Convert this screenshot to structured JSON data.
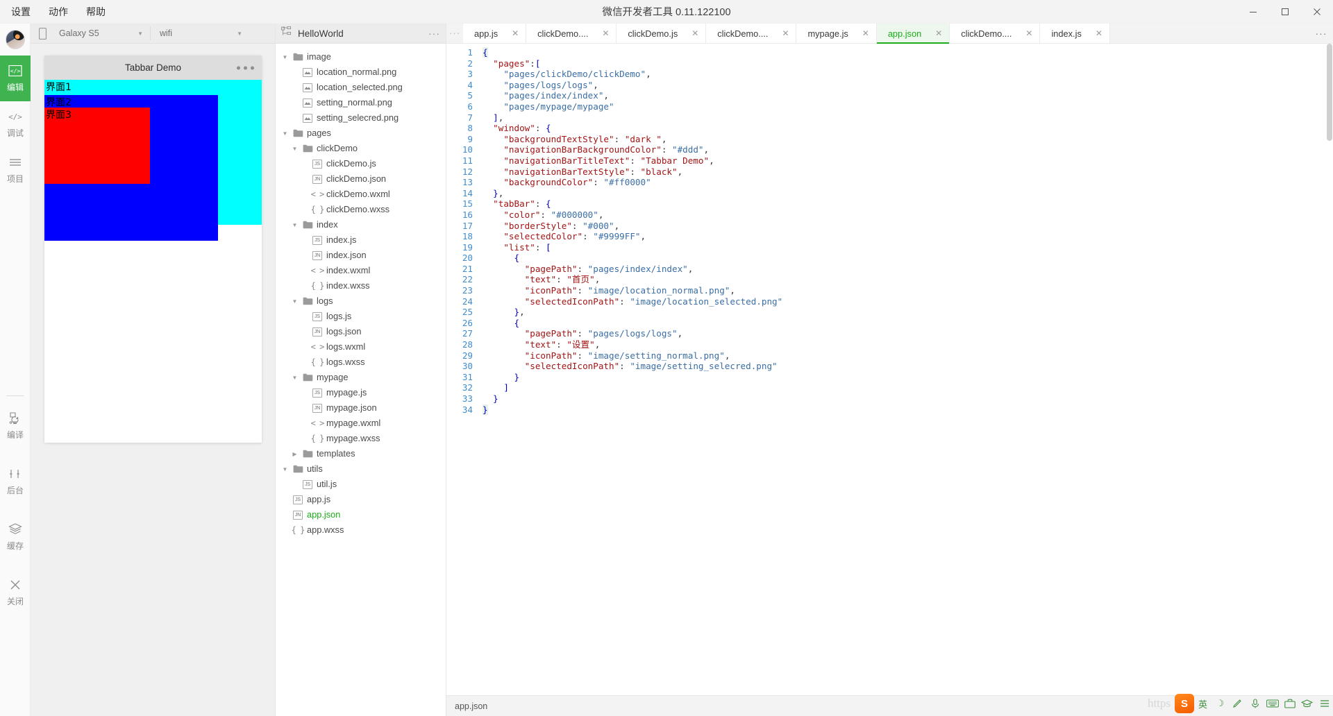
{
  "titlebar": {
    "menus": [
      {
        "label": "设置",
        "name": "menu-settings"
      },
      {
        "label": "动作",
        "name": "menu-actions"
      },
      {
        "label": "帮助",
        "name": "menu-help"
      }
    ],
    "app_title": "微信开发者工具 0.11.122100",
    "window_buttons": [
      {
        "name": "minimize-button",
        "glyph": "minimize"
      },
      {
        "name": "maximize-button",
        "glyph": "maximize"
      },
      {
        "name": "close-button",
        "glyph": "close"
      }
    ]
  },
  "rail": {
    "avatar_name": "user-avatar",
    "items": [
      {
        "label": "编辑",
        "icon": "code-edit-icon",
        "active": true
      },
      {
        "label": "调试",
        "icon": "code-debug-icon",
        "active": false
      },
      {
        "label": "项目",
        "icon": "list-project-icon",
        "active": false
      },
      {
        "label": "编译",
        "icon": "compile-refresh-icon",
        "active": false
      },
      {
        "label": "后台",
        "icon": "background-icon",
        "active": false
      },
      {
        "label": "缓存",
        "icon": "cache-layers-icon",
        "active": false
      },
      {
        "label": "关闭",
        "icon": "close-x-icon",
        "active": false
      }
    ]
  },
  "simulator": {
    "phone_icon": "phone-icon",
    "device_select": {
      "value": "Galaxy S5",
      "caret": "▼"
    },
    "network_select": {
      "value": "wifi",
      "caret": "▼"
    },
    "nav_title": "Tabbar Demo",
    "menu_dots": "···",
    "views": [
      {
        "label": "界面1",
        "color": "#00ffff"
      },
      {
        "label": "界面2",
        "color": "#0000ff"
      },
      {
        "label": "界面3",
        "color": "#ff0000"
      }
    ]
  },
  "tree": {
    "project_icon": "sitemap-icon",
    "project_name": "HelloWorld",
    "more_icon": "more-horizontal-icon",
    "items": [
      {
        "label": "image",
        "depth": 0,
        "type": "folder",
        "open": true
      },
      {
        "label": "location_normal.png",
        "depth": 1,
        "type": "image"
      },
      {
        "label": "location_selected.png",
        "depth": 1,
        "type": "image"
      },
      {
        "label": "setting_normal.png",
        "depth": 1,
        "type": "image"
      },
      {
        "label": "setting_selecred.png",
        "depth": 1,
        "type": "image"
      },
      {
        "label": "pages",
        "depth": 0,
        "type": "folder",
        "open": true
      },
      {
        "label": "clickDemo",
        "depth": 1,
        "type": "folder",
        "open": true
      },
      {
        "label": "clickDemo.js",
        "depth": 2,
        "type": "js"
      },
      {
        "label": "clickDemo.json",
        "depth": 2,
        "type": "json"
      },
      {
        "label": "clickDemo.wxml",
        "depth": 2,
        "type": "wxml"
      },
      {
        "label": "clickDemo.wxss",
        "depth": 2,
        "type": "wxss"
      },
      {
        "label": "index",
        "depth": 1,
        "type": "folder",
        "open": true
      },
      {
        "label": "index.js",
        "depth": 2,
        "type": "js"
      },
      {
        "label": "index.json",
        "depth": 2,
        "type": "json"
      },
      {
        "label": "index.wxml",
        "depth": 2,
        "type": "wxml"
      },
      {
        "label": "index.wxss",
        "depth": 2,
        "type": "wxss"
      },
      {
        "label": "logs",
        "depth": 1,
        "type": "folder",
        "open": true
      },
      {
        "label": "logs.js",
        "depth": 2,
        "type": "js"
      },
      {
        "label": "logs.json",
        "depth": 2,
        "type": "json"
      },
      {
        "label": "logs.wxml",
        "depth": 2,
        "type": "wxml"
      },
      {
        "label": "logs.wxss",
        "depth": 2,
        "type": "wxss"
      },
      {
        "label": "mypage",
        "depth": 1,
        "type": "folder",
        "open": true
      },
      {
        "label": "mypage.js",
        "depth": 2,
        "type": "js"
      },
      {
        "label": "mypage.json",
        "depth": 2,
        "type": "json"
      },
      {
        "label": "mypage.wxml",
        "depth": 2,
        "type": "wxml"
      },
      {
        "label": "mypage.wxss",
        "depth": 2,
        "type": "wxss"
      },
      {
        "label": "templates",
        "depth": 1,
        "type": "folder",
        "open": false
      },
      {
        "label": "utils",
        "depth": 0,
        "type": "folder",
        "open": true
      },
      {
        "label": "util.js",
        "depth": 1,
        "type": "js"
      },
      {
        "label": "app.js",
        "depth": 0,
        "type": "js"
      },
      {
        "label": "app.json",
        "depth": 0,
        "type": "json",
        "active": true
      },
      {
        "label": "app.wxss",
        "depth": 0,
        "type": "wxss"
      }
    ]
  },
  "editor": {
    "tabs_more_icon": "tabs-scroll-left-icon",
    "tabs_overflow_icon": "tabs-overflow-icon",
    "tabs": [
      {
        "label": "app.js",
        "close": "✕",
        "current": false
      },
      {
        "label": "clickDemo....",
        "close": "✕",
        "current": false
      },
      {
        "label": "clickDemo.js",
        "close": "✕",
        "current": false
      },
      {
        "label": "clickDemo....",
        "close": "✕",
        "current": false
      },
      {
        "label": "mypage.js",
        "close": "✕",
        "current": false
      },
      {
        "label": "app.json",
        "close": "✕",
        "current": true
      },
      {
        "label": "clickDemo....",
        "close": "✕",
        "current": false
      },
      {
        "label": "index.js",
        "close": "✕",
        "current": false
      }
    ],
    "line_numbers": [
      1,
      2,
      3,
      4,
      5,
      6,
      7,
      8,
      9,
      10,
      11,
      12,
      13,
      14,
      15,
      16,
      17,
      18,
      19,
      20,
      21,
      22,
      23,
      24,
      25,
      26,
      27,
      28,
      29,
      30,
      31,
      32,
      33,
      34
    ],
    "code_lines": [
      "{",
      "  \"pages\":[",
      "    \"pages/clickDemo/clickDemo\",",
      "    \"pages/logs/logs\",",
      "    \"pages/index/index\",",
      "    \"pages/mypage/mypage\"",
      "  ],",
      "  \"window\": {",
      "    \"backgroundTextStyle\": \"dark \",",
      "    \"navigationBarBackgroundColor\": \"#ddd\",",
      "    \"navigationBarTitleText\": \"Tabbar Demo\",",
      "    \"navigationBarTextStyle\": \"black\",",
      "    \"backgroundColor\": \"#ff0000\"",
      "  },",
      "  \"tabBar\": {",
      "    \"color\": \"#000000\",",
      "    \"borderStyle\": \"#000\",",
      "    \"selectedColor\": \"#9999FF\",",
      "    \"list\": [",
      "      {",
      "        \"pagePath\": \"pages/index/index\",",
      "        \"text\": \"首页\",",
      "        \"iconPath\": \"image/location_normal.png\",",
      "        \"selectedIconPath\": \"image/location_selected.png\"",
      "      },",
      "      {",
      "        \"pagePath\": \"pages/logs/logs\",",
      "        \"text\": \"设置\",",
      "        \"iconPath\": \"image/setting_normal.png\",",
      "        \"selectedIconPath\": \"image/setting_selecred.png\"",
      "      }",
      "    ]",
      "  }",
      "}"
    ],
    "status_text": "app.json"
  },
  "ime": {
    "watermark": "https",
    "logo_text": "S",
    "buttons": [
      {
        "glyph": "英",
        "name": "ime-lang-english"
      },
      {
        "glyph": "☽",
        "name": "ime-moon-icon"
      },
      {
        "glyph": "✎",
        "name": "ime-pen-icon"
      },
      {
        "glyph": "🎤",
        "name": "ime-mic-icon"
      },
      {
        "glyph": "⌨",
        "name": "ime-keyboard-icon"
      },
      {
        "glyph": "🗂",
        "name": "ime-toolbox-icon"
      },
      {
        "glyph": "🎩",
        "name": "ime-hat-icon"
      },
      {
        "glyph": "☰",
        "name": "ime-menu-icon"
      }
    ]
  },
  "colors": {
    "accent_green": "#1aad19",
    "rail_active": "#3eb34f",
    "gutter_blue": "#3f8cd0",
    "string_red": "#a31515",
    "path_blue": "#3a6ea5"
  }
}
